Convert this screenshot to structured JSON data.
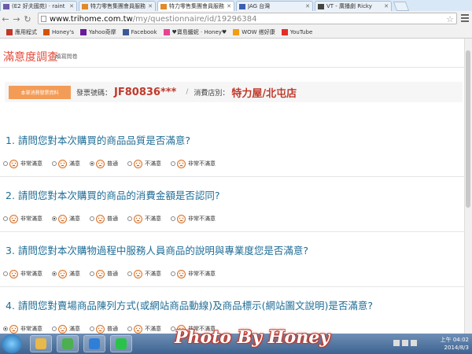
{
  "browser": {
    "tabs": [
      {
        "label": "(E2 好夫國苑) · raint",
        "color": "#6b5ba8"
      },
      {
        "label": "特力零售集團會員服務",
        "color": "#e08a2a"
      },
      {
        "label": "特力零售集團會員服務",
        "color": "#e08a2a",
        "active": true
      },
      {
        "label": "JAG 台灣",
        "color": "#3a5fb0"
      },
      {
        "label": "VT - 廣播劇 Ricky",
        "color": "#444"
      }
    ],
    "url_host": "www.trihome.com.tw",
    "url_path": "/my/questionnaire/id/19296384",
    "bookmarks": [
      {
        "label": "應用程式",
        "color": "#c0392b"
      },
      {
        "label": "Honey's",
        "color": "#d35400"
      },
      {
        "label": "Yahoo奇摩",
        "color": "#6a1b9a"
      },
      {
        "label": "Facebook",
        "color": "#3b5998"
      },
      {
        "label": "♥寶島醬妮 · Honey♥",
        "color": "#e84393"
      },
      {
        "label": "WOW 搭好康",
        "color": "#f39c12"
      },
      {
        "label": "YouTube",
        "color": "#e52d27"
      }
    ]
  },
  "page": {
    "title": "滿意度調查",
    "subtitle": "/ 填寫問卷",
    "info": {
      "button": "本單消費發票資料",
      "invoice_label": "發票號碼：",
      "invoice_value": "JF80836***",
      "separator": "/",
      "store_label": "消費店別：",
      "store_value": "特力屋/北屯店"
    },
    "questions": [
      {
        "text": "1. 請問您對本次購買的商品品質是否滿意?",
        "selected": 2
      },
      {
        "text": "2. 請問您對本次購買的商品的消費金額是否認同?",
        "selected": 1
      },
      {
        "text": "3. 請問您對本次購物過程中服務人員商品的說明與專業度您是否滿意?",
        "selected": 1
      },
      {
        "text": "4. 請問您對賣場商品陳列方式(或網站商品動線)及商品標示(網站圖文說明)是否滿意?",
        "selected": 0
      }
    ],
    "options": [
      "非常滿意",
      "滿意",
      "普通",
      "不滿意",
      "非常不滿意"
    ]
  },
  "taskbar": {
    "apps": [
      {
        "name": "explorer",
        "color": "#e8b84a"
      },
      {
        "name": "chrome",
        "color": "#4caf50"
      },
      {
        "name": "ie",
        "color": "#2f7fd8"
      },
      {
        "name": "line",
        "color": "#2bc24b"
      }
    ],
    "time_period": "上午",
    "time": "04:02",
    "date": "2014/8/3"
  },
  "watermark": "Photo By Honey"
}
